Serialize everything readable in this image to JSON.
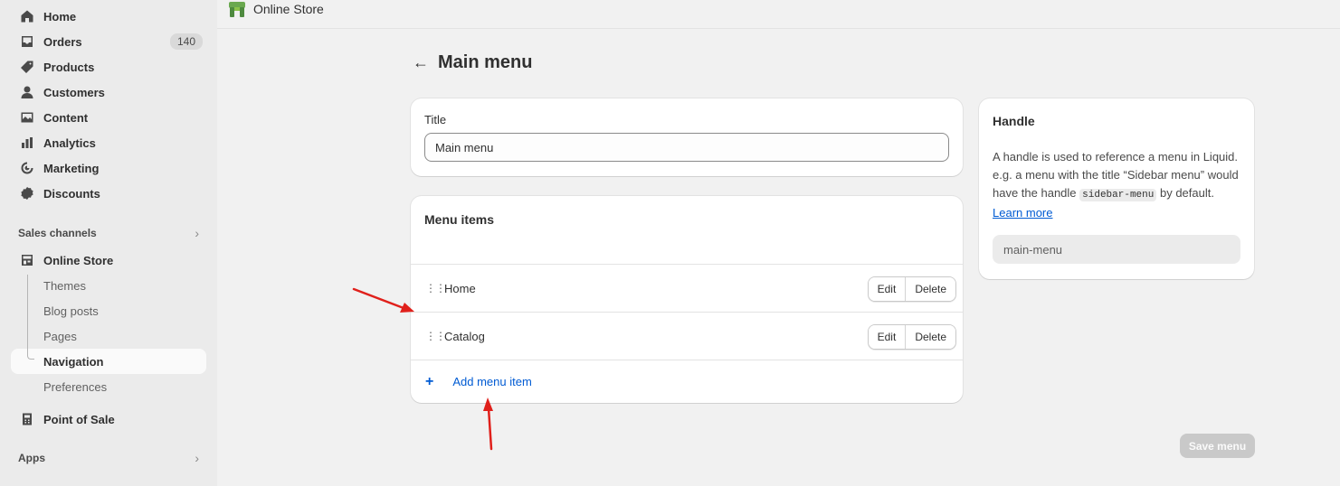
{
  "sidebar": {
    "items": [
      {
        "label": "Home",
        "icon": "home-icon"
      },
      {
        "label": "Orders",
        "icon": "inbox-icon",
        "badge": "140"
      },
      {
        "label": "Products",
        "icon": "tag-icon"
      },
      {
        "label": "Customers",
        "icon": "person-icon"
      },
      {
        "label": "Content",
        "icon": "image-icon"
      },
      {
        "label": "Analytics",
        "icon": "bar-chart-icon"
      },
      {
        "label": "Marketing",
        "icon": "target-icon"
      },
      {
        "label": "Discounts",
        "icon": "discount-icon"
      }
    ],
    "sales_channels_label": "Sales channels",
    "online_store_label": "Online Store",
    "sub_items": [
      "Themes",
      "Blog posts",
      "Pages",
      "Navigation",
      "Preferences"
    ],
    "active_sub_item": "Navigation",
    "point_of_sale_label": "Point of Sale",
    "apps_label": "Apps"
  },
  "topbar": {
    "title": "Online Store"
  },
  "page": {
    "title": "Main menu"
  },
  "title_card": {
    "label": "Title",
    "value": "Main menu"
  },
  "menu_card": {
    "title": "Menu items",
    "items": [
      {
        "label": "Home",
        "edit": "Edit",
        "delete": "Delete"
      },
      {
        "label": "Catalog",
        "edit": "Edit",
        "delete": "Delete"
      }
    ],
    "add_label": "Add menu item",
    "add_symbol": "+"
  },
  "handle_card": {
    "title": "Handle",
    "desc_part1": "A handle is used to reference a menu in Liquid. e.g. a menu with the title “Sidebar menu” would have the handle ",
    "desc_code": "sidebar-menu",
    "desc_part2": " by default.",
    "learn_more": "Learn more",
    "value": "main-menu"
  },
  "actions": {
    "save_label": "Save menu"
  },
  "colors": {
    "accent": "#005bd3",
    "annotation_arrow": "#e0201b",
    "sidebar_bg": "#ebebeb",
    "page_bg": "#f1f1f1",
    "logo_green": "#4e8a3f"
  }
}
